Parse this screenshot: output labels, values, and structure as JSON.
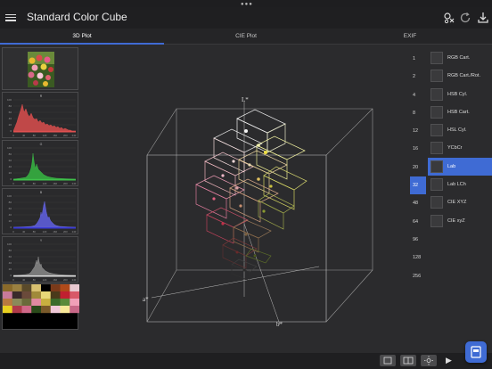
{
  "app": {
    "title": "Standard Color Cube"
  },
  "tabs": [
    {
      "label": "3D Plot",
      "active": true
    },
    {
      "label": "CIE Plot",
      "active": false
    },
    {
      "label": "EXIF",
      "active": false
    }
  ],
  "histograms": [
    {
      "channel": "R",
      "color": "#e05050",
      "yticks": [
        "100",
        "80",
        "60",
        "40",
        "20",
        "0"
      ],
      "xticks": [
        "0",
        "40",
        "80",
        "120",
        "160",
        "200",
        "240"
      ]
    },
    {
      "channel": "G",
      "color": "#3fc04a",
      "yticks": [
        "100",
        "80",
        "60",
        "40",
        "20",
        "0"
      ],
      "xticks": [
        "0",
        "40",
        "80",
        "120",
        "160",
        "200",
        "240"
      ]
    },
    {
      "channel": "B",
      "color": "#6a6ae8",
      "yticks": [
        "100",
        "80",
        "60",
        "40",
        "20",
        "0"
      ],
      "xticks": [
        "0",
        "40",
        "80",
        "120",
        "160",
        "200",
        "240"
      ]
    },
    {
      "channel": "Y",
      "color": "#9a9a9a",
      "yticks": [
        "100",
        "80",
        "60",
        "40",
        "20",
        "0"
      ],
      "xticks": [
        "0",
        "40",
        "80",
        "120",
        "160",
        "200",
        "240"
      ]
    }
  ],
  "palette": [
    "#8a6a2a",
    "#9a8040",
    "#5a4a2a",
    "#d8c070",
    "#000000",
    "#7a3a1a",
    "#b04a1a",
    "#e8c8d0",
    "#c87a9a",
    "#3a2a2a",
    "#6a4a3a",
    "#a08a3a",
    "#e8d878",
    "#4a3a1a",
    "#c02030",
    "#d85868",
    "#b87a40",
    "#8a8a5a",
    "#6a6a3a",
    "#e08aa0",
    "#c8b040",
    "#3a6a2a",
    "#5a8a3a",
    "#f0a0b8",
    "#e8d020",
    "#b03a4a",
    "#d06888",
    "#2a4a1a",
    "#7a5a2a",
    "#f0c8d8",
    "#f8e898",
    "#c86888"
  ],
  "plot": {
    "axes": {
      "l": "L*",
      "a": "a*",
      "b": "b*"
    }
  },
  "resolutions": [
    {
      "label": "1",
      "active": false
    },
    {
      "label": "2",
      "active": false
    },
    {
      "label": "4",
      "active": false
    },
    {
      "label": "8",
      "active": false
    },
    {
      "label": "12",
      "active": false
    },
    {
      "label": "16",
      "active": false
    },
    {
      "label": "20",
      "active": false
    },
    {
      "label": "32",
      "active": true
    },
    {
      "label": "48",
      "active": false
    },
    {
      "label": "64",
      "active": false
    },
    {
      "label": "96",
      "active": false
    },
    {
      "label": "128",
      "active": false
    },
    {
      "label": "256",
      "active": false
    }
  ],
  "color_spaces": [
    {
      "label": "RGB Cart.",
      "active": false
    },
    {
      "label": "RGB Cart./Rot.",
      "active": false
    },
    {
      "label": "HSB Cyl.",
      "active": false
    },
    {
      "label": "HSB Cart.",
      "active": false
    },
    {
      "label": "HSL Cyl.",
      "active": false
    },
    {
      "label": "YCbCr",
      "active": false
    },
    {
      "label": "Lab",
      "active": true
    },
    {
      "label": "Lab LCh",
      "active": false
    },
    {
      "label": "CIE XYZ",
      "active": false
    },
    {
      "label": "CIE xyZ",
      "active": false
    }
  ],
  "icons": {
    "menu": "menu-icon",
    "palette": "palette-icon",
    "refresh": "refresh-icon",
    "download": "download-icon",
    "play": "play-icon",
    "accent": "#3f6bd4"
  }
}
